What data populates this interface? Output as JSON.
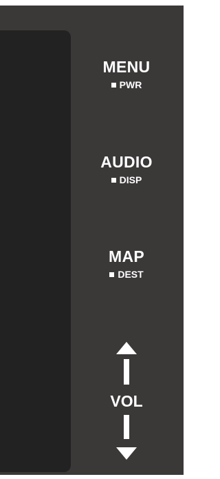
{
  "buttons": {
    "menu": {
      "label": "MENU",
      "secondary": "PWR"
    },
    "audio": {
      "label": "AUDIO",
      "secondary": "DISP"
    },
    "map": {
      "label": "MAP",
      "secondary": "DEST"
    }
  },
  "volume": {
    "label": "VOL",
    "up_icon": "triangle-up-icon",
    "down_icon": "triangle-down-icon"
  },
  "colors": {
    "bezel": "#3b3838",
    "screen": "#232222",
    "text": "#ffffff"
  }
}
